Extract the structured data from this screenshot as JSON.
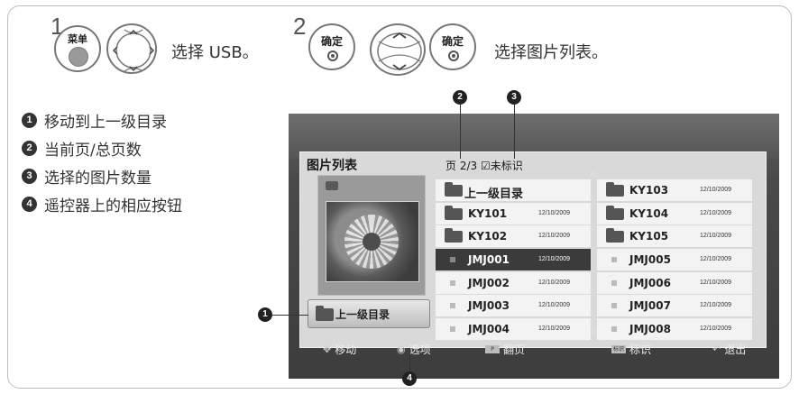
{
  "step1": {
    "number": "1",
    "menu_button_label": "菜单",
    "text": "选择 USB。"
  },
  "step2": {
    "number": "2",
    "ok_button_label": "确定",
    "ok_button2_label": "确定",
    "text": "选择图片列表。"
  },
  "legend": [
    {
      "num": "1",
      "text": "移动到上一级目录"
    },
    {
      "num": "2",
      "text": "当前页/总页数"
    },
    {
      "num": "3",
      "text": "选择的图片数量"
    },
    {
      "num": "4",
      "text": "遥控器上的相应按钮"
    }
  ],
  "callouts": {
    "c1": "1",
    "c2": "2",
    "c3": "3",
    "c4": "4"
  },
  "screen": {
    "title": "图片列表",
    "page_info": "页 2/3 ☑未标识",
    "up_button_label": "上一级目录",
    "left_column": [
      {
        "type": "up",
        "name": "上一级目录",
        "date": ""
      },
      {
        "type": "folder",
        "name": "KY101",
        "date": "12/10/2009"
      },
      {
        "type": "folder",
        "name": "KY102",
        "date": "12/10/2009"
      },
      {
        "type": "file",
        "name": "JMJ001",
        "date": "12/10/2009",
        "selected": true
      },
      {
        "type": "file",
        "name": "JMJ002",
        "date": "12/10/2009"
      },
      {
        "type": "file",
        "name": "JMJ003",
        "date": "12/10/2009"
      },
      {
        "type": "file",
        "name": "JMJ004",
        "date": "12/10/2009"
      }
    ],
    "right_column": [
      {
        "type": "folder",
        "name": "KY103",
        "date": "12/10/2009"
      },
      {
        "type": "folder",
        "name": "KY104",
        "date": "12/10/2009"
      },
      {
        "type": "folder",
        "name": "KY105",
        "date": "12/10/2009"
      },
      {
        "type": "file",
        "name": "JMJ005",
        "date": "12/10/2009"
      },
      {
        "type": "file",
        "name": "JMJ006",
        "date": "12/10/2009"
      },
      {
        "type": "file",
        "name": "JMJ007",
        "date": "12/10/2009"
      },
      {
        "type": "file",
        "name": "JMJ008",
        "date": "12/10/2009"
      }
    ],
    "footer": {
      "move": "移动",
      "options": "选项",
      "page_key": "P",
      "page": "翻页",
      "mark_key": "标识",
      "mark": "标识",
      "exit": "退出"
    }
  }
}
